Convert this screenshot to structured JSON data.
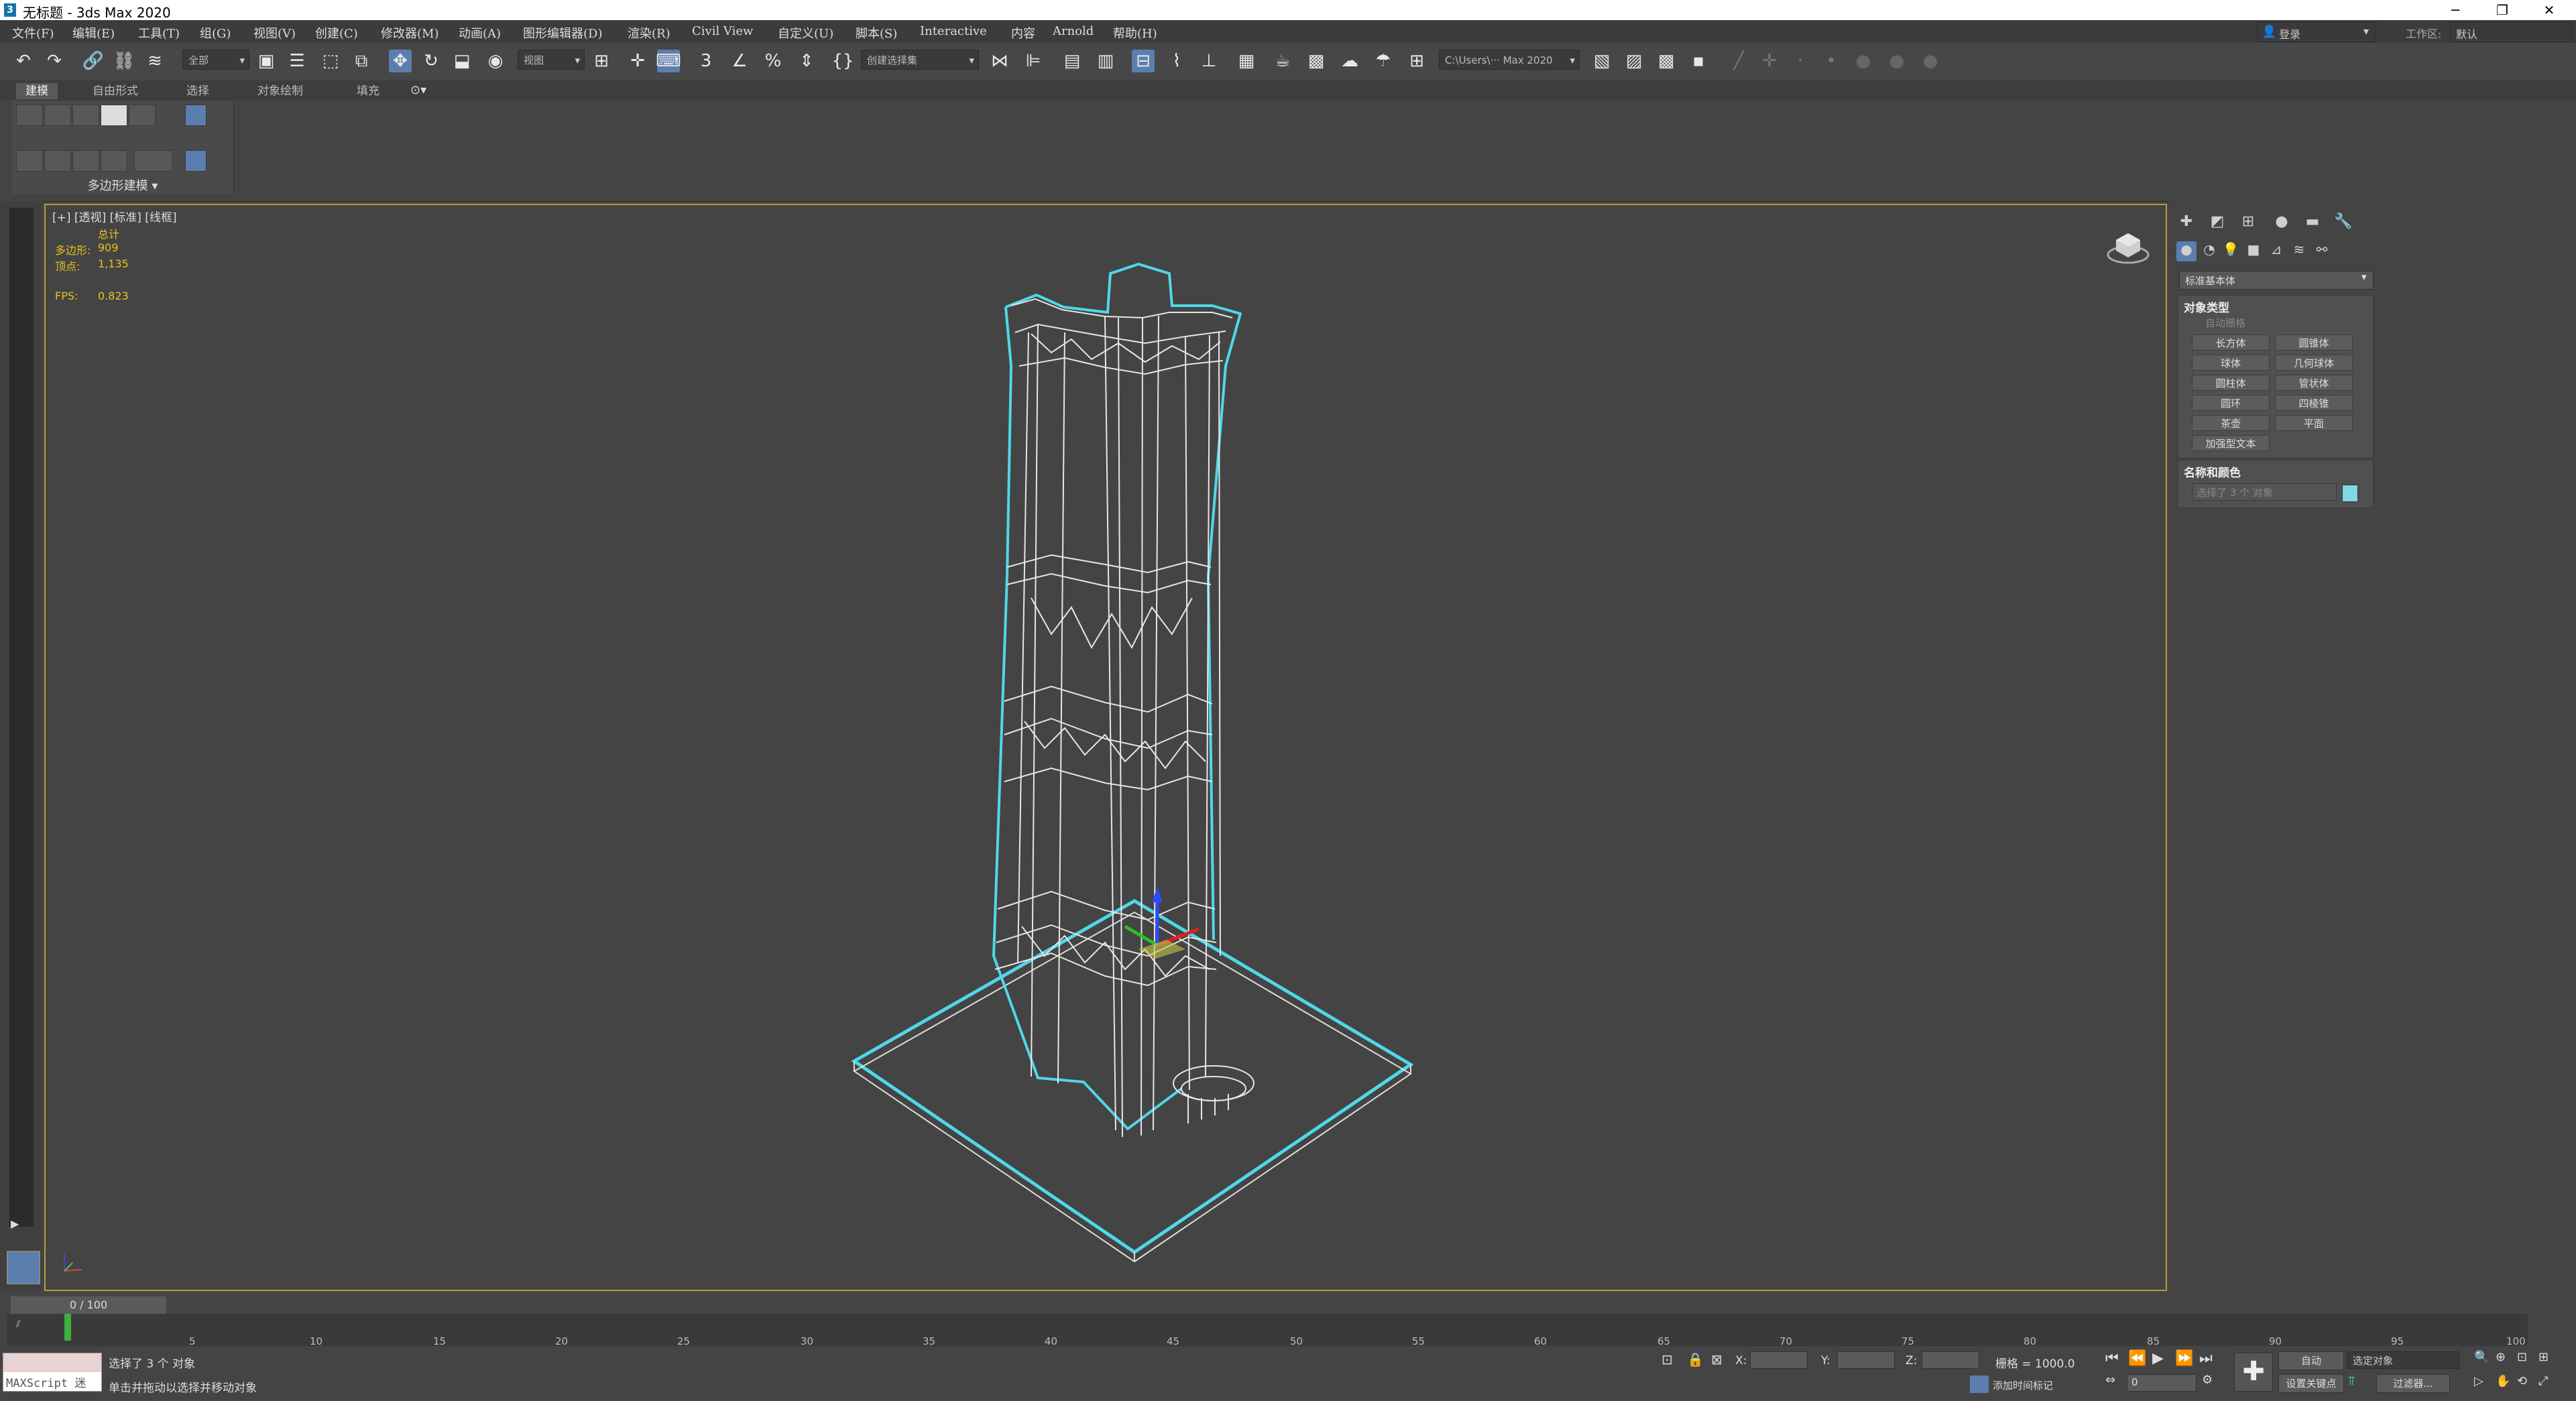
{
  "window": {
    "title": "无标题 - 3ds Max 2020",
    "minimize": "─",
    "maximize": "❐",
    "close": "✕"
  },
  "menu": [
    "文件(F)",
    "编辑(E)",
    "工具(T)",
    "组(G)",
    "视图(V)",
    "创建(C)",
    "修改器(M)",
    "动画(A)",
    "图形编辑器(D)",
    "渲染(R)",
    "Civil View",
    "自定义(U)",
    "脚本(S)",
    "Interactive",
    "内容",
    "Arnold",
    "帮助(H)"
  ],
  "account": {
    "login_label": "登录",
    "workspace_label": "工作区:",
    "workspace_value": "默认"
  },
  "toolbar": {
    "filter_value": "全部",
    "refcoord_value": "视图",
    "selection_set_placeholder": "创建选择集",
    "path_value": "C:\\Users\\··· Max 2020"
  },
  "ribbon": {
    "tabs": [
      "建模",
      "自由形式",
      "选择",
      "对象绘制",
      "填充"
    ],
    "active_tab": "建模",
    "panel_label": "多边形建模 ▾"
  },
  "viewport": {
    "label": "[+] [透视] [标准] [线框]",
    "stats": {
      "total_label": "总计",
      "polys_label": "多边形:",
      "polys_value": "909",
      "verts_label": "顶点:",
      "verts_value": "1,135",
      "fps_label": "FPS:",
      "fps_value": "0.823"
    }
  },
  "command_panel": {
    "category": "标准基本体",
    "object_type": {
      "title": "对象类型",
      "autogrid": "自动栅格",
      "buttons": [
        "长方体",
        "圆锥体",
        "球体",
        "几何球体",
        "圆柱体",
        "管状体",
        "圆环",
        "四棱锥",
        "茶壶",
        "平面",
        "加强型文本"
      ]
    },
    "name_color": {
      "title": "名称和颜色",
      "name_value": "选择了 3 个 对象",
      "color": "#7fd8e8"
    }
  },
  "timeline": {
    "slider_text": "0 / 100",
    "ticks": [
      "5",
      "10",
      "15",
      "20",
      "25",
      "30",
      "35",
      "40",
      "45",
      "50",
      "55",
      "60",
      "65",
      "70",
      "75",
      "80",
      "85",
      "90",
      "95",
      "100"
    ]
  },
  "status": {
    "maxscript_label": "MAXScript 迷",
    "selected_text": "选择了 3 个 对象",
    "prompt_text": "单击并拖动以选择并移动对象",
    "x_label": "X:",
    "y_label": "Y:",
    "z_label": "Z:",
    "grid_text": "栅格 = 1000.0",
    "add_time_tag": "添加时间标记",
    "auto_key": "自动",
    "selected_object": "选定对象",
    "set_key": "设置关键点",
    "filters": "过滤器...",
    "frame_value": "0"
  },
  "colors": {
    "accent": "#5a7fae",
    "selection_wire": "#4fd8e8",
    "viewport_border": "#b89a3c",
    "stats_text": "#e8c21c"
  }
}
